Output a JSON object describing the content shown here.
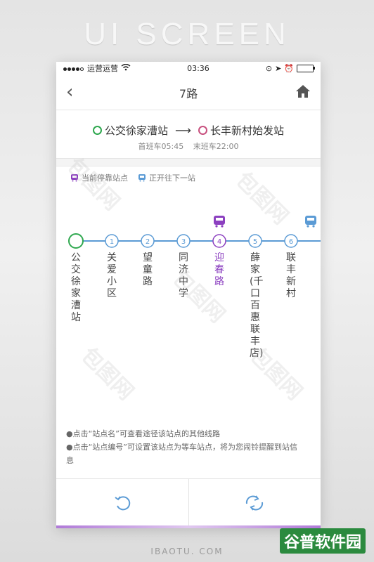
{
  "banner": "UI SCREEN",
  "status": {
    "carrier": "运营运营",
    "time": "03:36"
  },
  "nav": {
    "title": "7路"
  },
  "route": {
    "from": "公交徐家漕站",
    "to": "长丰新村始发站",
    "first_bus": "首班车05:45",
    "last_bus": "末班车22:00"
  },
  "legend": {
    "stopped": "当前停靠站点",
    "moving": "正开往下一站"
  },
  "stops": [
    {
      "num": "",
      "name": "公交徐家漕站"
    },
    {
      "num": "1",
      "name": "关爱小区"
    },
    {
      "num": "2",
      "name": "望童路"
    },
    {
      "num": "3",
      "name": "同济中学"
    },
    {
      "num": "4",
      "name": "迎春路"
    },
    {
      "num": "5",
      "name": "薛家(千口百惠联丰店)"
    },
    {
      "num": "6",
      "name": "联丰新村"
    }
  ],
  "tips": [
    "●点击“站点名”可查看途径该站点的其他线路",
    "●点击“站点编号”可设置该站点为等车站点，将为您闹铃提醒到站信息"
  ],
  "footer": "IBAOTU. COM",
  "brand": "谷普软件园",
  "watermark": "包图网",
  "colors": {
    "accent": "#8c40c0",
    "line": "#5b9bd5",
    "start": "#2fa84f",
    "end": "#c8517f"
  }
}
